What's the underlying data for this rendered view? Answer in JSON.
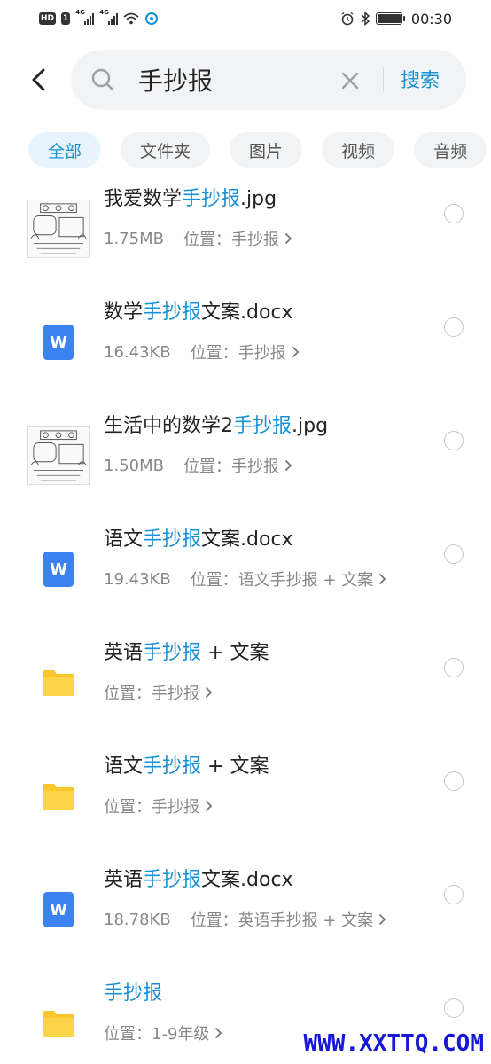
{
  "status_bar": {
    "hd": "HD",
    "sim": "1",
    "net1": "4G",
    "net2": "4G",
    "time": "00:30"
  },
  "search": {
    "query": "手抄报",
    "search_label": "搜索"
  },
  "tabs": [
    {
      "label": "全部",
      "active": true
    },
    {
      "label": "文件夹",
      "active": false
    },
    {
      "label": "图片",
      "active": false
    },
    {
      "label": "视频",
      "active": false
    },
    {
      "label": "音频",
      "active": false
    }
  ],
  "location_prefix": "位置：",
  "results": [
    {
      "type": "image",
      "title_pre": "我爱数学",
      "title_hl": "手抄报",
      "title_post": ".jpg",
      "size": "1.75MB",
      "location": "手抄报"
    },
    {
      "type": "doc",
      "title_pre": "数学",
      "title_hl": "手抄报",
      "title_post": "文案.docx",
      "size": "16.43KB",
      "location": "手抄报"
    },
    {
      "type": "image",
      "title_pre": "生活中的数学2",
      "title_hl": "手抄报",
      "title_post": ".jpg",
      "size": "1.50MB",
      "location": "手抄报"
    },
    {
      "type": "doc",
      "title_pre": "语文",
      "title_hl": "手抄报",
      "title_post": "文案.docx",
      "size": "19.43KB",
      "location": "语文手抄报 + 文案"
    },
    {
      "type": "folder",
      "title_pre": "英语",
      "title_hl": "手抄报",
      "title_post": " + 文案",
      "size": "",
      "location": "手抄报"
    },
    {
      "type": "folder",
      "title_pre": "语文",
      "title_hl": "手抄报",
      "title_post": " + 文案",
      "size": "",
      "location": "手抄报"
    },
    {
      "type": "doc",
      "title_pre": "英语",
      "title_hl": "手抄报",
      "title_post": "文案.docx",
      "size": "18.78KB",
      "location": "英语手抄报 + 文案"
    },
    {
      "type": "folder",
      "title_pre": "",
      "title_hl": "手抄报",
      "title_post": "",
      "size": "",
      "location": "1-9年级"
    }
  ],
  "doc_glyph": "W",
  "watermark": "WWW.XXTTQ.COM",
  "colors": {
    "accent": "#1890d4",
    "doc": "#3b82f0",
    "folder": "#f9c62e"
  }
}
